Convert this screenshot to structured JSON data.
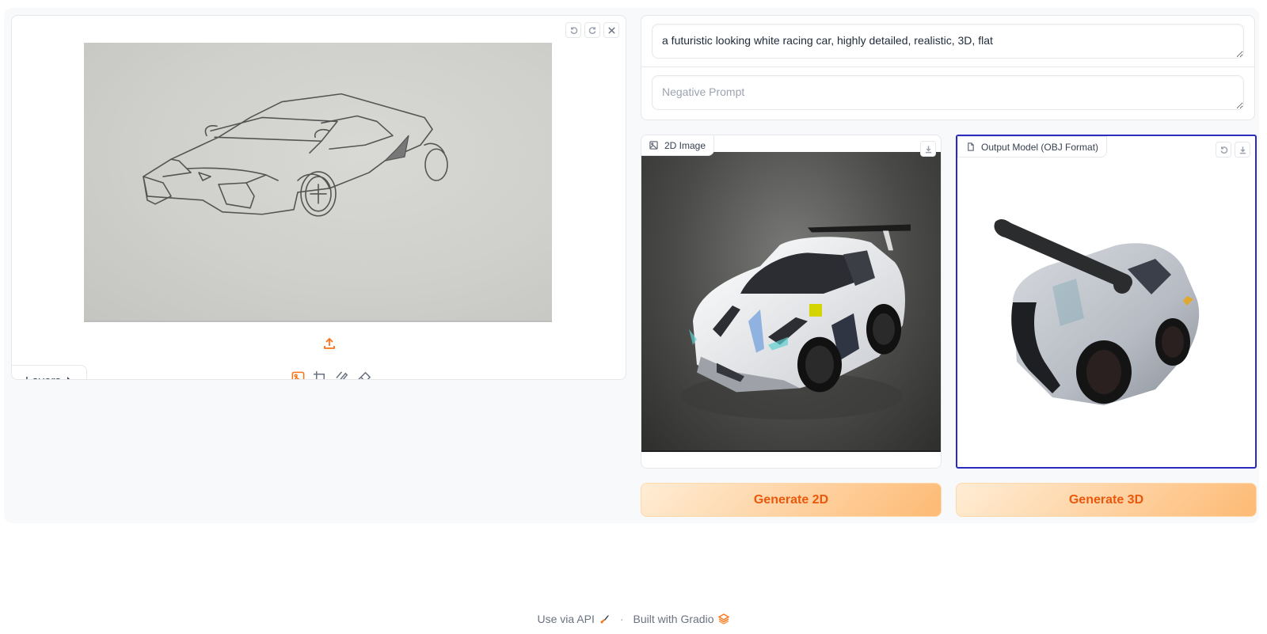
{
  "editor": {
    "undo_label": "undo",
    "redo_label": "redo",
    "clear_label": "clear",
    "image_alt": "pencil sketch of a sports car",
    "layers_label": "Layers",
    "tools": [
      {
        "name": "image",
        "active": true
      },
      {
        "name": "crop",
        "active": false
      },
      {
        "name": "brush",
        "active": false
      },
      {
        "name": "eraser",
        "active": false
      }
    ]
  },
  "prompts": {
    "prompt_value": "a futuristic looking white racing car, highly detailed, realistic, 3D, flat",
    "negative_placeholder": "Negative Prompt",
    "negative_value": ""
  },
  "image_output": {
    "label": "2D Image",
    "image_alt": "generated white futuristic racing car"
  },
  "model_output": {
    "label": "Output Model (OBJ Format)",
    "model_alt": "3D reconstructed car model"
  },
  "buttons": {
    "generate_2d": "Generate 2D",
    "generate_3d": "Generate 3D"
  },
  "footer": {
    "api_label": "Use via API",
    "separator": "·",
    "built_label": "Built with Gradio"
  },
  "colors": {
    "accent": "#f97316",
    "button_text": "#ea580c",
    "model_border": "#2b2bbf"
  }
}
